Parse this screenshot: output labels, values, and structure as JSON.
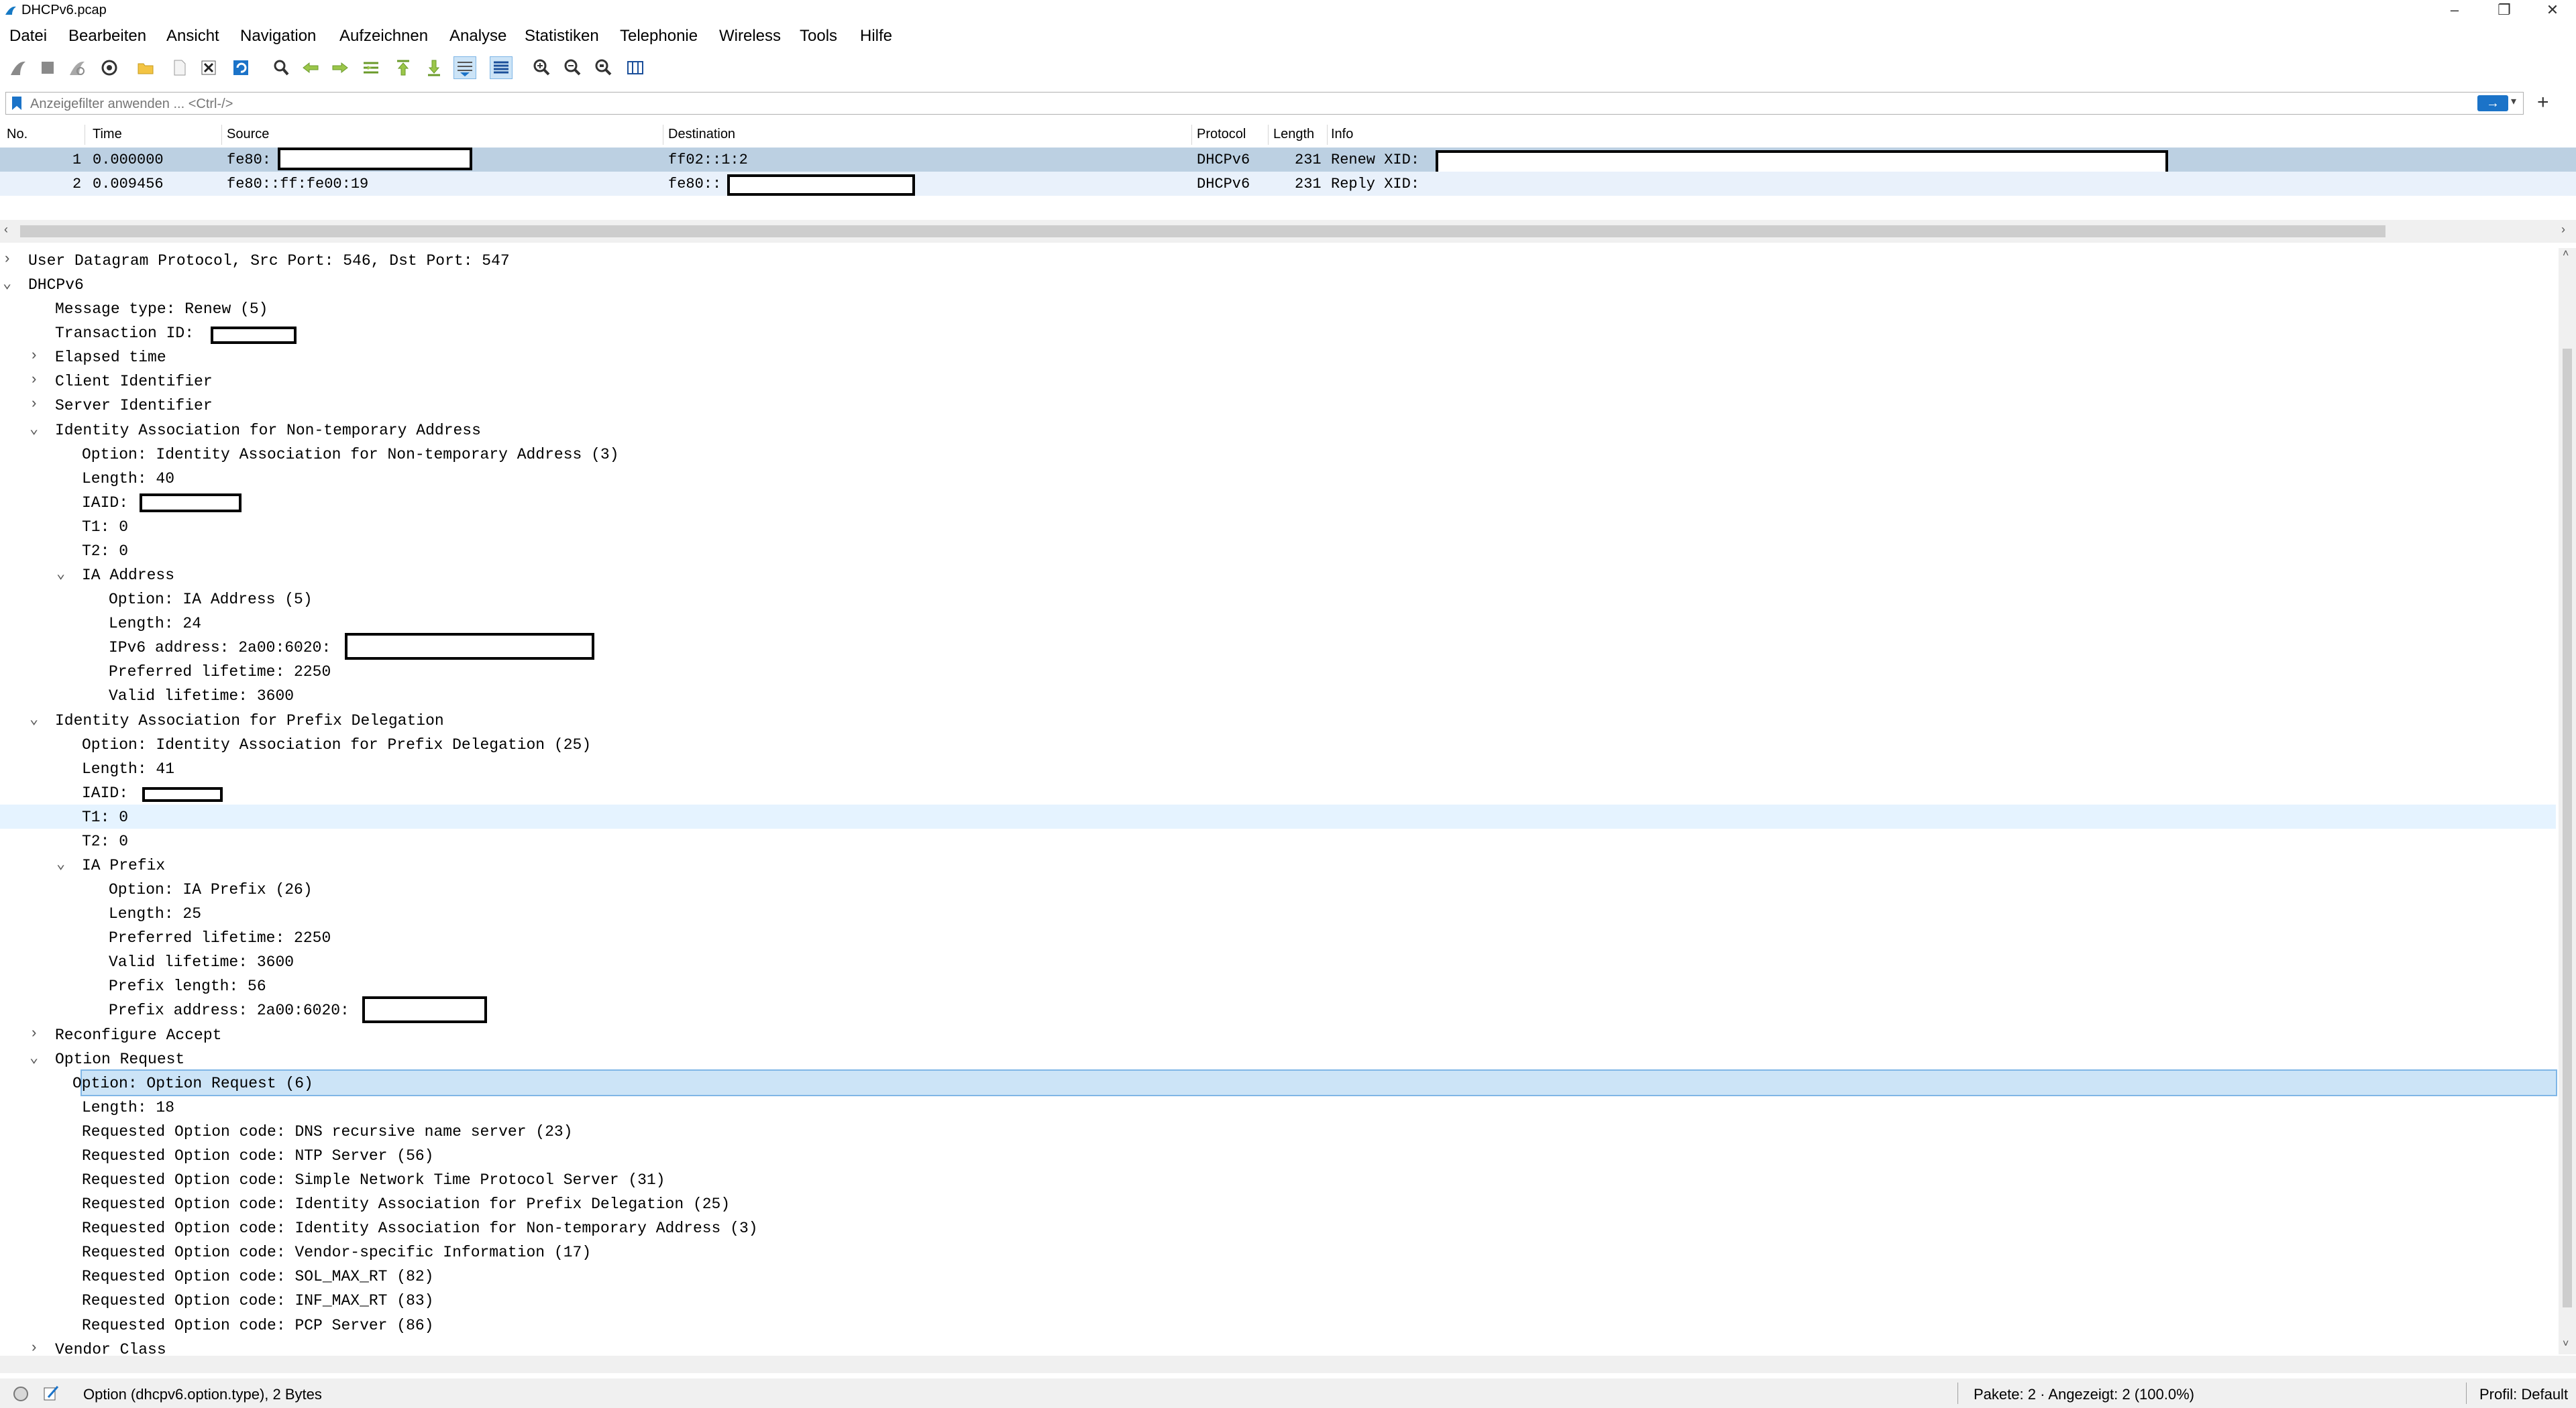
{
  "window": {
    "title": "DHCPv6.pcap",
    "minimize": "–",
    "restore": "❐",
    "close": "✕"
  },
  "menu": [
    "Datei",
    "Bearbeiten",
    "Ansicht",
    "Navigation",
    "Aufzeichnen",
    "Analyse",
    "Statistiken",
    "Telephonie",
    "Wireless",
    "Tools",
    "Hilfe"
  ],
  "toolbar_icons": [
    "shark-fin-start-icon",
    "stop-square-icon",
    "restart-fin-icon",
    "capture-options-gear-icon",
    "open-folder-icon",
    "save-file-icon",
    "close-file-icon",
    "reload-icon",
    "search-magnifier-icon",
    "back-arrow-icon",
    "forward-arrow-icon",
    "go-to-packet-icon",
    "first-packet-icon",
    "last-packet-icon",
    "autoscroll-icon",
    "colorize-icon",
    "zoom-in-icon",
    "zoom-out-icon",
    "zoom-normal-icon",
    "resize-columns-icon"
  ],
  "filter": {
    "placeholder": "Anzeigefilter anwenden ... <Ctrl-/>",
    "apply": "→",
    "add": "+"
  },
  "packet_list": {
    "columns": [
      "No.",
      "Time",
      "Source",
      "Destination",
      "Protocol",
      "Length",
      "Info"
    ],
    "rows": [
      {
        "no": "1",
        "time": "0.000000",
        "source": "fe80:",
        "destination": "ff02::1:2",
        "protocol": "DHCPv6",
        "length": "231",
        "info": "Renew XID:"
      },
      {
        "no": "2",
        "time": "0.009456",
        "source": "fe80::ff:fe00:19",
        "destination": "fe80::",
        "protocol": "DHCPv6",
        "length": "231",
        "info": "Reply XID:"
      }
    ]
  },
  "detail": [
    {
      "level": 0,
      "arrow": "›",
      "text": "User Datagram Protocol, Src Port: 546, Dst Port: 547"
    },
    {
      "level": 0,
      "arrow": "⌄",
      "text": "DHCPv6"
    },
    {
      "level": 1,
      "arrow": "",
      "text": "Message type: Renew (5)"
    },
    {
      "level": 1,
      "arrow": "",
      "text": "Transaction ID: "
    },
    {
      "level": 1,
      "arrow": "›",
      "text": "Elapsed time"
    },
    {
      "level": 1,
      "arrow": "›",
      "text": "Client Identifier"
    },
    {
      "level": 1,
      "arrow": "›",
      "text": "Server Identifier"
    },
    {
      "level": 1,
      "arrow": "⌄",
      "text": "Identity Association for Non-temporary Address"
    },
    {
      "level": 2,
      "arrow": "",
      "text": "Option: Identity Association for Non-temporary Address (3)"
    },
    {
      "level": 2,
      "arrow": "",
      "text": "Length: 40"
    },
    {
      "level": 2,
      "arrow": "",
      "text": "IAID: "
    },
    {
      "level": 2,
      "arrow": "",
      "text": "T1: 0"
    },
    {
      "level": 2,
      "arrow": "",
      "text": "T2: 0"
    },
    {
      "level": 2,
      "arrow": "⌄",
      "text": "IA Address"
    },
    {
      "level": 3,
      "arrow": "",
      "text": "Option: IA Address (5)"
    },
    {
      "level": 3,
      "arrow": "",
      "text": "Length: 24"
    },
    {
      "level": 3,
      "arrow": "",
      "text": "IPv6 address: 2a00:6020:"
    },
    {
      "level": 3,
      "arrow": "",
      "text": "Preferred lifetime: 2250"
    },
    {
      "level": 3,
      "arrow": "",
      "text": "Valid lifetime: 3600"
    },
    {
      "level": 1,
      "arrow": "⌄",
      "text": "Identity Association for Prefix Delegation"
    },
    {
      "level": 2,
      "arrow": "",
      "text": "Option: Identity Association for Prefix Delegation (25)"
    },
    {
      "level": 2,
      "arrow": "",
      "text": "Length: 41"
    },
    {
      "level": 2,
      "arrow": "",
      "text": "IAID: "
    },
    {
      "level": 2,
      "arrow": "",
      "text": "T1: 0"
    },
    {
      "level": 2,
      "arrow": "",
      "text": "T2: 0"
    },
    {
      "level": 2,
      "arrow": "⌄",
      "text": "IA Prefix"
    },
    {
      "level": 3,
      "arrow": "",
      "text": "Option: IA Prefix (26)"
    },
    {
      "level": 3,
      "arrow": "",
      "text": "Length: 25"
    },
    {
      "level": 3,
      "arrow": "",
      "text": "Preferred lifetime: 2250"
    },
    {
      "level": 3,
      "arrow": "",
      "text": "Valid lifetime: 3600"
    },
    {
      "level": 3,
      "arrow": "",
      "text": "Prefix length: 56"
    },
    {
      "level": 3,
      "arrow": "",
      "text": "Prefix address: 2a00:6020:"
    },
    {
      "level": 1,
      "arrow": "›",
      "text": "Reconfigure Accept"
    },
    {
      "level": 1,
      "arrow": "⌄",
      "text": "Option Request"
    },
    {
      "level": 2,
      "arrow": "",
      "text": "Option: Option Request (6)"
    },
    {
      "level": 2,
      "arrow": "",
      "text": "Length: 18"
    },
    {
      "level": 2,
      "arrow": "",
      "text": "Requested Option code: DNS recursive name server (23)"
    },
    {
      "level": 2,
      "arrow": "",
      "text": "Requested Option code: NTP Server (56)"
    },
    {
      "level": 2,
      "arrow": "",
      "text": "Requested Option code: Simple Network Time Protocol Server (31)"
    },
    {
      "level": 2,
      "arrow": "",
      "text": "Requested Option code: Identity Association for Prefix Delegation (25)"
    },
    {
      "level": 2,
      "arrow": "",
      "text": "Requested Option code: Identity Association for Non-temporary Address (3)"
    },
    {
      "level": 2,
      "arrow": "",
      "text": "Requested Option code: Vendor-specific Information (17)"
    },
    {
      "level": 2,
      "arrow": "",
      "text": "Requested Option code: SOL_MAX_RT (82)"
    },
    {
      "level": 2,
      "arrow": "",
      "text": "Requested Option code: INF_MAX_RT (83)"
    },
    {
      "level": 2,
      "arrow": "",
      "text": "Requested Option code: PCP Server (86)"
    },
    {
      "level": 1,
      "arrow": "›",
      "text": "Vendor Class"
    }
  ],
  "status": {
    "field": "Option (dhcpv6.option.type), 2 Bytes",
    "packets": "Pakete: 2 · Angezeigt: 2 (100.0%)",
    "profile": "Profil: Default"
  },
  "colors": {
    "selected_packet_row": "#bcd0e2",
    "second_packet_row": "#e9f1fb",
    "selected_detail": "#cce4f7",
    "hover_detail": "#e5f3ff"
  }
}
